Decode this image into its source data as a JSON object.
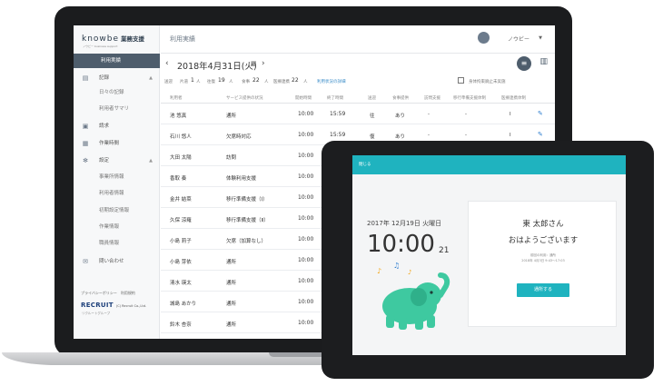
{
  "laptop": {
    "brand": "knowbe",
    "app_name": "業務支援",
    "brand_sub": "ノウビー business support",
    "sidebar": {
      "active": "利用実績",
      "records": "記録",
      "daily_record": "日々の記録",
      "user_summary": "利用者サマリ",
      "billing": "請求",
      "work_time": "作業時間",
      "settings": "設定",
      "office_info": "事業所情報",
      "user_info": "利用者情報",
      "initial_settings": "初期設定情報",
      "work_info": "作業情報",
      "staff_info": "職員情報",
      "contact": "問い合わせ",
      "privacy": "プライバシーポリシー　利用規約",
      "company": "RECRUIT",
      "copyright": "(C) Recruit Co.,Ltd.",
      "company_sub": "リクルートグループ"
    },
    "header": {
      "title": "利用実績",
      "user": "ノウビー"
    },
    "date": {
      "prev": "‹",
      "value": "2018年4月31日(火)",
      "next": "›"
    },
    "summary": {
      "commute_label": "送迎",
      "pickup_label": "片道",
      "pickup_count": "1",
      "pickup_unit": "人",
      "round_label": "往復",
      "round_count": "19",
      "round_unit": "人",
      "meal_label": "食事",
      "meal_count": "22",
      "meal_unit": "人",
      "medical_label": "医療連携",
      "medical_count": "22",
      "medical_unit": "人",
      "detail_link": "利用状況の詳細",
      "restraint_label": "身体拘束廃止未実施"
    },
    "table": {
      "headers": [
        "利用者",
        "サービス提供の状況",
        "開始時間",
        "終了時間",
        "送迎",
        "食事提供",
        "訪問支援",
        "移行準備支援体制",
        "医療連携体制"
      ],
      "rows": [
        {
          "name": "池 悠真",
          "status": "通所",
          "start": "10:00",
          "end": "15:59",
          "commute": "往",
          "meal": "あり",
          "visit": "-",
          "transition": "-",
          "medical": "Ⅰ",
          "edit": "✎"
        },
        {
          "name": "石川 悠人",
          "status": "欠席時対応",
          "start": "10:00",
          "end": "15:59",
          "commute": "復",
          "meal": "あり",
          "visit": "-",
          "transition": "-",
          "medical": "Ⅰ",
          "edit": "✎"
        },
        {
          "name": "大田 太陽",
          "status": "訪問",
          "start": "10:00",
          "end": "",
          "commute": "",
          "meal": "",
          "visit": "",
          "transition": "",
          "medical": "",
          "edit": ""
        },
        {
          "name": "香取 奏",
          "status": "体験利用支援",
          "start": "10:00",
          "end": "",
          "commute": "",
          "meal": "",
          "visit": "",
          "transition": "",
          "medical": "",
          "edit": ""
        },
        {
          "name": "金井 結菜",
          "status": "移行準備支援（Ⅰ）",
          "start": "10:00",
          "end": "",
          "commute": "",
          "meal": "",
          "visit": "",
          "transition": "",
          "medical": "",
          "edit": ""
        },
        {
          "name": "久保 涼羅",
          "status": "移行準備支援（Ⅱ）",
          "start": "10:00",
          "end": "",
          "commute": "",
          "meal": "",
          "visit": "",
          "transition": "",
          "medical": "",
          "edit": ""
        },
        {
          "name": "小島 莉子",
          "status": "欠席（加算なし）",
          "start": "10:00",
          "end": "",
          "commute": "",
          "meal": "",
          "visit": "",
          "transition": "",
          "medical": "",
          "edit": ""
        },
        {
          "name": "小島 芽依",
          "status": "通所",
          "start": "10:00",
          "end": "",
          "commute": "",
          "meal": "",
          "visit": "",
          "transition": "",
          "medical": "",
          "edit": ""
        },
        {
          "name": "清水 瑛太",
          "status": "通所",
          "start": "10:00",
          "end": "",
          "commute": "",
          "meal": "",
          "visit": "",
          "transition": "",
          "medical": "",
          "edit": ""
        },
        {
          "name": "城島 あかり",
          "status": "通所",
          "start": "10:00",
          "end": "",
          "commute": "",
          "meal": "",
          "visit": "",
          "transition": "",
          "medical": "",
          "edit": ""
        },
        {
          "name": "鈴木 杏奈",
          "status": "通所",
          "start": "10:00",
          "end": "",
          "commute": "",
          "meal": "",
          "visit": "",
          "transition": "",
          "medical": "",
          "edit": ""
        }
      ]
    }
  },
  "tablet": {
    "header_label": "閉じる",
    "date": "2017年 12月19日 火曜日",
    "time": "10:00",
    "seconds": "21",
    "user_name": "東 太郎さん",
    "greeting": "おはようございます",
    "prev_label": "前回の利用：通所",
    "prev_time": "2018年 4月3日 9:43～17:03",
    "checkin_button": "通所する"
  },
  "colors": {
    "sidebar_active": "#4e5d6c",
    "accent_teal": "#1fb3bf",
    "elephant": "#3ec9a0",
    "edit_blue": "#2f7fcf"
  }
}
